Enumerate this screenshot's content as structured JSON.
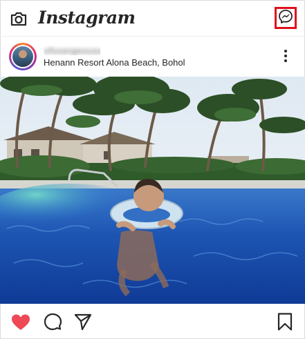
{
  "app": {
    "brand": "Instagram"
  },
  "header": {
    "camera_icon": "camera-icon",
    "messenger_icon": "messenger-icon",
    "highlight_color": "#e0101c"
  },
  "post": {
    "username": "ofsoergeousa",
    "location": "Henann Resort Alona Beach, Bohol",
    "image_alt": "Baby floating in a swim ring in a resort pool with palm trees",
    "liked": true,
    "like_color": "#ed4956"
  },
  "actions": {
    "like_icon": "heart-icon",
    "comment_icon": "comment-icon",
    "share_icon": "paper-plane-icon",
    "save_icon": "bookmark-icon"
  }
}
